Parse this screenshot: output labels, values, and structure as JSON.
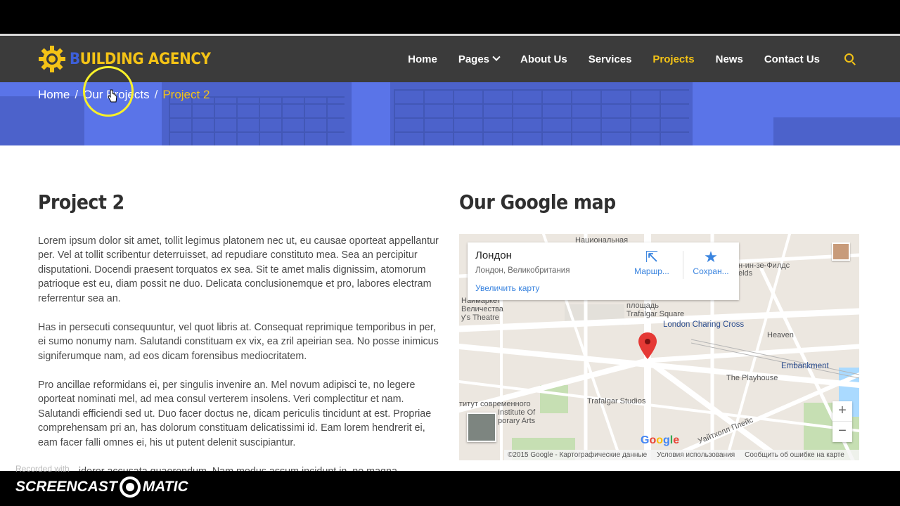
{
  "logo": {
    "first_letter": "B",
    "rest": "UILDING AGENCY"
  },
  "nav": {
    "items": [
      {
        "label": "Home"
      },
      {
        "label": "Pages"
      },
      {
        "label": "About Us"
      },
      {
        "label": "Services"
      },
      {
        "label": "Projects"
      },
      {
        "label": "News"
      },
      {
        "label": "Contact Us"
      }
    ],
    "active": "Projects",
    "accent_color": "#f4c316"
  },
  "breadcrumb": {
    "home": "Home",
    "parent": "Our Projects",
    "current": "Project 2",
    "separator": "/"
  },
  "project": {
    "title": "Project 2",
    "paragraphs": [
      "Lorem ipsum dolor sit amet, tollit legimus platonem nec ut, eu causae oporteat appellantur per. Vel at tollit scribentur deterruisset, ad repudiare constituto mea. Sea an percipitur disputationi. Docendi praesent torquatos ex sea. Sit te amet malis dignissim, atomorum patrioque est eu, diam possit ne duo. Delicata conclusionemque et pro, labores electram referrentur sea an.",
      "Has in persecuti consequuntur, vel quot libris at. Consequat reprimique temporibus in per, ei sumo nonumy nam. Salutandi constituam ex vix, ea zril apeirian sea. No posse inimicus signiferumque nam, ad eos dicam forensibus mediocritatem.",
      "Pro ancillae reformidans ei, per singulis invenire an. Mel novum adipisci te, no legere oporteat nominati mel, ad mea consul verterem insolens. Veri complectitur et nam. Salutandi efficiendi sed ut. Duo facer doctus ne, dicam periculis tincidunt at est. Propriae comprehensam pri an, has dolorum constituam delicatissimi id. Eam lorem hendrerit ei, eam facer falli omnes ei, his ut putent delenit suscipiantur.",
      "...iderer accusata quaerendum. Nam modus assum incidunt in, ne magna"
    ]
  },
  "map_section": {
    "title": "Our Google map",
    "card": {
      "place": "Лондон",
      "address": "Лондон, Великобритания",
      "enlarge": "Увеличить карту",
      "directions": "Маршр...",
      "save": "Сохран..."
    },
    "labels": {
      "gallery": "Национальная",
      "fields": "н-ин-зе-Филдс",
      "fields2": "elds",
      "theatre1": "Величества",
      "theatre2": "y's Theatre",
      "theatre0": "Hаймаркет",
      "square1": "площадь",
      "square2": "Trafalgar Square",
      "charing": "London Charing Cross",
      "heaven": "Heaven",
      "embankment": "Embankment",
      "playhouse": "The Playhouse",
      "ica1": "титут современного",
      "ica2": "Institute Of",
      "ica3": "porary Arts",
      "studios": "Trafalgar Studios",
      "whitehall": "Уайтхолл Плейс"
    },
    "google": [
      "G",
      "o",
      "o",
      "g",
      "l",
      "e"
    ],
    "google_colors": [
      "#4285f4",
      "#ea4335",
      "#fbbc05",
      "#4285f4",
      "#34a853",
      "#ea4335"
    ],
    "footer": [
      "©2015 Google - Картографические данные",
      "Условия использования",
      "Сообщить об ошибке на карте"
    ]
  },
  "watermark": {
    "recorded": "Recorded with",
    "brand_left": "SCREENCAST",
    "brand_right": "MATIC"
  }
}
